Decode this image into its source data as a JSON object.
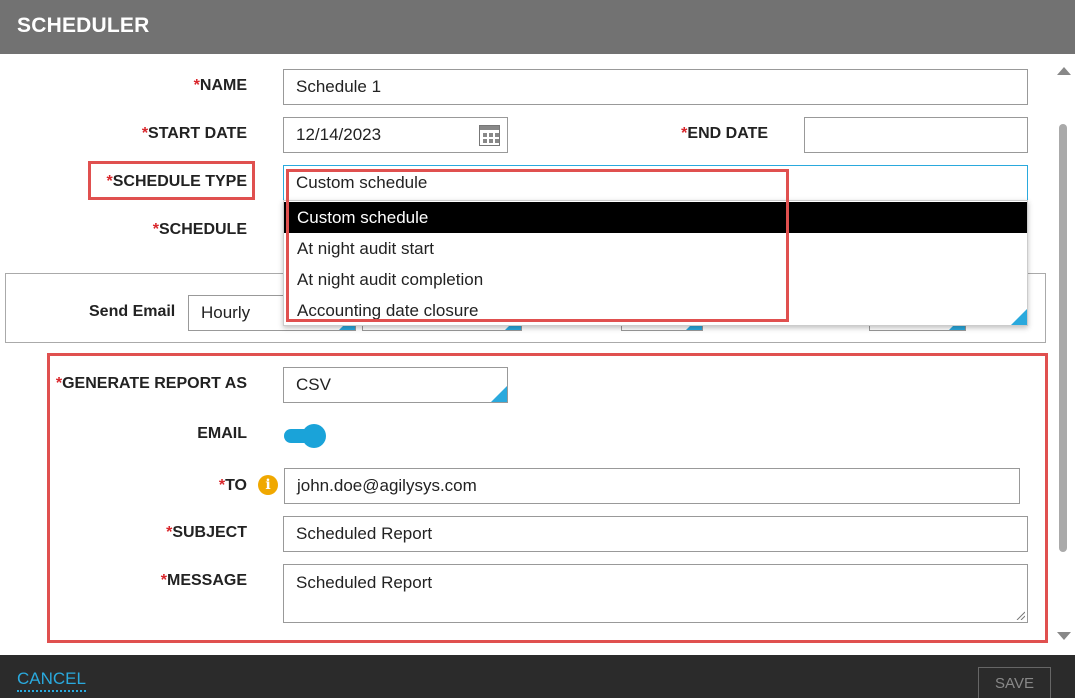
{
  "window": {
    "title": "SCHEDULER"
  },
  "required_marker": "*",
  "form": {
    "name": {
      "label": "NAME",
      "value": "Schedule 1"
    },
    "start_date": {
      "label": "START DATE",
      "value": "12/14/2023"
    },
    "end_date": {
      "label": "END DATE",
      "value": ""
    },
    "schedule_type": {
      "label": "SCHEDULE TYPE",
      "value": "Custom schedule",
      "options": [
        "Custom schedule",
        "At night audit start",
        "At night audit completion",
        "Accounting date closure"
      ],
      "highlighted_option": "Custom schedule"
    },
    "schedule": {
      "label": "SCHEDULE"
    },
    "send_email": {
      "label": "Send Email",
      "frequency": "Hourly"
    },
    "generate_report_as": {
      "label": "GENERATE REPORT AS",
      "value": "CSV"
    },
    "email": {
      "label": "EMAIL",
      "toggle_on": true
    },
    "to": {
      "label": "TO",
      "value": "john.doe@agilysys.com",
      "info_icon": "info-icon"
    },
    "subject": {
      "label": "SUBJECT",
      "value": "Scheduled Report"
    },
    "message": {
      "label": "MESSAGE",
      "value": "Scheduled Report"
    }
  },
  "footer": {
    "cancel_label": "CANCEL",
    "save_label": "SAVE"
  },
  "colors": {
    "titlebar": "#727272",
    "accent": "#2aa9dd",
    "toggle": "#1aa3d9",
    "required": "#d9262b",
    "highlight_box": "#e0504f",
    "info_icon": "#f0a800",
    "footer": "#2b2b2b"
  }
}
